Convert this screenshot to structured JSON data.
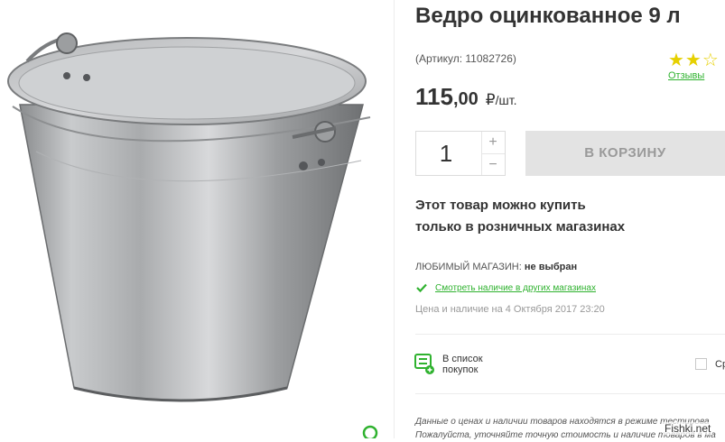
{
  "product": {
    "title": "Ведро оцинкованное 9 л",
    "sku": "(Артикул: 11082726)",
    "rating_stars": "★★☆",
    "reviews_label": "Отзывы",
    "price_int": "115",
    "price_dec": ",00",
    "currency": "₽",
    "unit": "/шт."
  },
  "cart": {
    "quantity": "1",
    "plus": "+",
    "minus": "−",
    "button_label": "В КОРЗИНУ"
  },
  "retail_note": {
    "line1": "Этот товар можно купить",
    "line2": "только в розничных магазинах"
  },
  "store": {
    "label": "ЛЮБИМЫЙ МАГАЗИН:",
    "value": "не выбран",
    "availability_link": "Смотреть наличие в других магазинах",
    "price_date": "Цена и наличие на 4 Октября 2017 23:20"
  },
  "actions": {
    "list_line1": "В список",
    "list_line2": "покупок",
    "compare_label": "Ср"
  },
  "disclaimer": {
    "line1": "Данные о ценах и наличии товаров находятся в режиме тестирова",
    "line2": "Пожалуйста, уточняйте точную стоимость и наличие товаров в ма"
  },
  "watermark": "Fishki.net",
  "colors": {
    "accent_green": "#2fb22f",
    "star_yellow": "#e6d000",
    "cart_button_bg": "#e3e3e3"
  }
}
